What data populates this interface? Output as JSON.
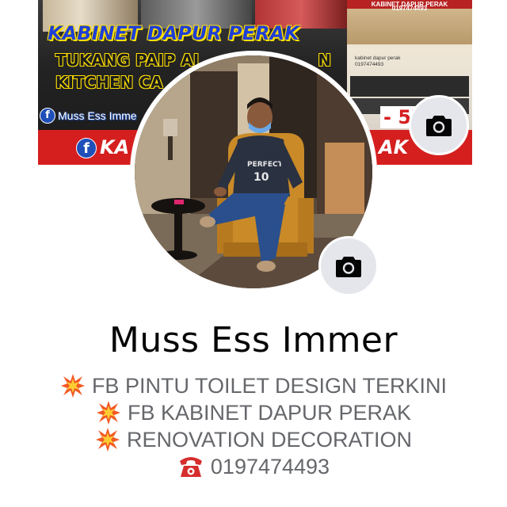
{
  "cover": {
    "title": "KABINET DAPUR PERAK",
    "subtitle_line1": "TUKANG PAIP AI",
    "subtitle_line1_tail": "N",
    "subtitle_line2": "KITCHEN CA",
    "fb_name": "Muss Ess Imme",
    "red_bar_left": "KA",
    "red_bar_right": "AK",
    "phone_partial": "- 57",
    "right_top_text": "KABINET DAPUR PERAK",
    "right_top_phone": "0197474493",
    "right_caption_line1": "kabinet dapur perak",
    "right_caption_line2": "0197474493",
    "colors": {
      "title_blue": "#1f3fd6",
      "outline_yellow": "#ffe000",
      "banner_red": "#d51f1f",
      "fb_blue": "#1f4fb8"
    }
  },
  "profile": {
    "name": "Muss Ess Immer",
    "shirt_text_top": "PERFECT",
    "shirt_text_number": "10",
    "bio": [
      {
        "icon": "explosion-emoji-icon",
        "text": "FB PINTU TOILET DESIGN TERKINI"
      },
      {
        "icon": "explosion-emoji-icon",
        "text": "FB KABINET DAPUR PERAK"
      },
      {
        "icon": "explosion-emoji-icon",
        "text": "RENOVATION DECORATION"
      },
      {
        "icon": "telephone-icon",
        "text": "0197474493"
      }
    ]
  },
  "buttons": {
    "cover_camera_icon": "camera-icon",
    "profile_camera_icon": "camera-icon"
  },
  "colors": {
    "name_text": "#050505",
    "bio_text": "#65676b",
    "camera_button_bg": "#e4e6eb"
  }
}
